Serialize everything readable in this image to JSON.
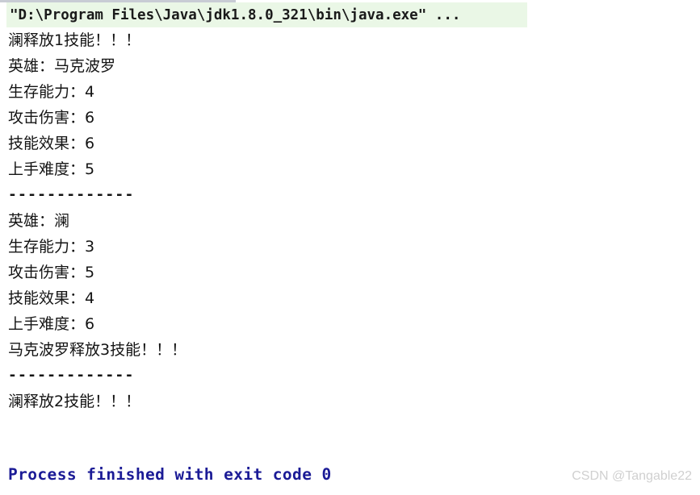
{
  "console": {
    "command_line": "\"D:\\Program Files\\Java\\jdk1.8.0_321\\bin\\java.exe\" ...",
    "lines": [
      {
        "text": "澜释放1技能！！！",
        "style": "text"
      },
      {
        "text": "英雄：马克波罗",
        "style": "text"
      },
      {
        "text": "生存能力：4",
        "style": "text"
      },
      {
        "text": "攻击伤害：6",
        "style": "text"
      },
      {
        "text": "技能效果：6",
        "style": "text"
      },
      {
        "text": "上手难度：5",
        "style": "text"
      },
      {
        "text": "-------------",
        "style": "mono-bold"
      },
      {
        "text": "英雄：澜",
        "style": "text"
      },
      {
        "text": "生存能力：3",
        "style": "text"
      },
      {
        "text": "攻击伤害：5",
        "style": "text"
      },
      {
        "text": "技能效果：4",
        "style": "text"
      },
      {
        "text": "上手难度：6",
        "style": "text"
      },
      {
        "text": "马克波罗释放3技能！！！",
        "style": "text"
      },
      {
        "text": "-------------",
        "style": "mono-bold"
      },
      {
        "text": "澜释放2技能！！！",
        "style": "text"
      },
      {
        "text": " ",
        "style": "blank"
      }
    ],
    "process_finished": "Process finished with exit code 0",
    "watermark": "CSDN @Tangable22",
    "colors": {
      "command_highlight_bg": "#eaf7e6",
      "command_text": "#1a1a1a",
      "output_text": "#141414",
      "process_finished_text": "#1b1b96",
      "watermark_text": "#d0d0d0",
      "top_strip": "#c8ccd4",
      "background": "#ffffff"
    }
  }
}
